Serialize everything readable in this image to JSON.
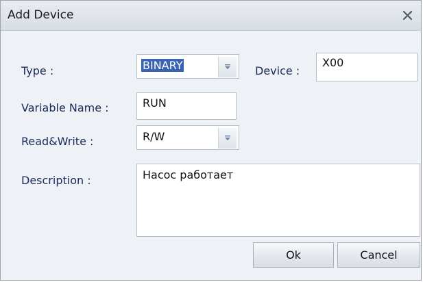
{
  "dialog": {
    "title": "Add Device",
    "close_icon": "close-icon"
  },
  "form": {
    "type_label": "Type :",
    "type_value": "BINARY",
    "device_label": "Device :",
    "device_value": "X00",
    "variable_name_label": "Variable Name :",
    "variable_name_value": "RUN",
    "read_write_label": "Read&Write :",
    "read_write_value": "R/W",
    "description_label": "Description :",
    "description_value": "Насос работает",
    "dropdown_icon": "chevron-down-icon"
  },
  "buttons": {
    "ok_label": "Ok",
    "cancel_label": "Cancel"
  },
  "colors": {
    "selection": "#3b63b4",
    "label_text": "#1a2a5a"
  }
}
